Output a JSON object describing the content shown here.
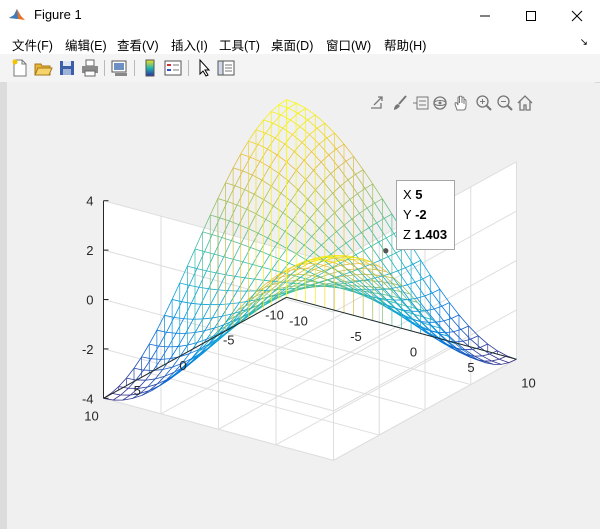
{
  "window": {
    "title": "Figure 1",
    "controls": [
      "minimize",
      "maximize",
      "close"
    ]
  },
  "menu": {
    "items": [
      "文件(F)",
      "编辑(E)",
      "查看(V)",
      "插入(I)",
      "工具(T)",
      "桌面(D)",
      "窗口(W)",
      "帮助(H)"
    ]
  },
  "toolbar": {
    "buttons": [
      "new-figure",
      "open-file",
      "save",
      "print",
      "link-plot",
      "insert-colorbar",
      "insert-legend",
      "edit-plot",
      "open-property-inspector"
    ]
  },
  "axes_toolbar": {
    "buttons": [
      "export",
      "brush",
      "data-tips",
      "rotate-3d",
      "pan",
      "zoom-in",
      "zoom-out",
      "restore-view"
    ]
  },
  "datatip": {
    "x_label": "X",
    "x_value": "5",
    "y_label": "Y",
    "y_value": "-2",
    "z_label": "Z",
    "z_value": "1.403"
  },
  "chart_data": {
    "type": "surface-mesh-3d",
    "function": "z = sin(x/2) * cos(y/5) * 4 (saddle shape)",
    "title": "",
    "xlabel": "",
    "ylabel": "",
    "zlabel": "",
    "xlim": [
      -10,
      10
    ],
    "ylim": [
      -10,
      10
    ],
    "zlim": [
      -4,
      4
    ],
    "x_ticks": [
      "-10",
      "-5",
      "0",
      "5",
      "10"
    ],
    "y_ticks": [
      "-10",
      "-5",
      "0",
      "5",
      "10"
    ],
    "z_ticks": [
      "-4",
      "-2",
      "0",
      "2",
      "4"
    ],
    "grid": true,
    "colormap": "parula",
    "highlight_point": {
      "x": 5,
      "y": -2,
      "z": 1.403
    }
  }
}
